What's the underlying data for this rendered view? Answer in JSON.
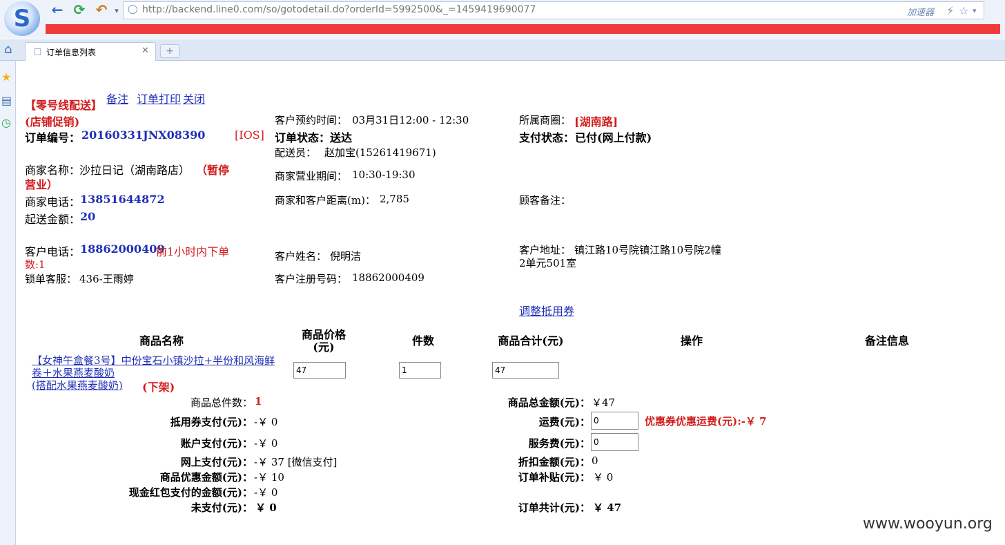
{
  "browser": {
    "url": "http://backend.line0.com/so/gotodetail.do?orderId=5992500&_=1459419690077",
    "accelerator": "加速器",
    "tab_title": "订单信息列表",
    "logo_glyph": "S",
    "icons": {
      "back": "back-arrow-icon",
      "refresh": "refresh-icon",
      "undo": "undo-icon"
    }
  },
  "header": {
    "delivery_tag": "【零号线配送】",
    "links": {
      "remark": "备注",
      "print": "订单打印",
      "close": "关闭"
    },
    "promo_tag": "(店铺促销)"
  },
  "order": {
    "number_label": "订单编号：",
    "number": "20160331JNX08390",
    "platform": "[IOS]",
    "merchant_name_label": "商家名称：",
    "merchant_name": "沙拉日记（湖南路店）",
    "merchant_status_line1": "（暂停",
    "merchant_status_line2": "营业）",
    "merchant_phone_label": "商家电话：",
    "merchant_phone": "13851644872",
    "min_amount_label": "起送金额：",
    "min_amount": "20",
    "customer_phone_label": "客户电话：",
    "customer_phone": "18862000409",
    "recent_orders_line1": "前1小时内下单",
    "recent_orders_line2": "数:1",
    "lock_cs_label": "锁单客服：",
    "lock_cs": "436-王雨婷",
    "appointment_label": "客户预约时间：",
    "appointment": "03月31日12:00 - 12:30",
    "status_label": "订单状态：",
    "status": "送达",
    "courier_label": "配送员：",
    "courier": "赵加宝(15261419671)",
    "hours_label": "商家营业期间：",
    "hours": "10:30-19:30",
    "distance_label": "商家和客户距离(m)：",
    "distance": "2,785",
    "customer_name_label": "客户姓名：",
    "customer_name": "倪明洁",
    "reg_phone_label": "客户注册号码：",
    "reg_phone": "18862000409",
    "district_label": "所属商圈：",
    "district": "[湖南路]",
    "pay_status_label": "支付状态：",
    "pay_status": "已付(网上付款)",
    "customer_note_label": "顾客备注：",
    "address_label": "客户地址：",
    "address_line1": "镇江路10号院镇江路10号院2幢",
    "address_line2": "2单元501室",
    "adjust_coupon": "调整抵用券"
  },
  "table": {
    "headers": {
      "name": "商品名称",
      "price_line1": "商品价格",
      "price_line2": "(元)",
      "qty": "件数",
      "subtotal": "商品合计(元)",
      "action": "操作",
      "note": "备注信息"
    },
    "rows": [
      {
        "name_line1": "【女神午盒餐3号】中份宝石小镇沙拉+半份和风海鲜",
        "name_line2": "卷＋水果燕麦酸奶",
        "name_line3": "(搭配水果燕麦酸奶)",
        "status": "(下架)",
        "price": "47",
        "qty": "1",
        "subtotal": "47"
      }
    ]
  },
  "summary": {
    "total_items_label": "商品总件数：",
    "total_items": "1",
    "coupon_pay_label": "抵用券支付(元)：",
    "coupon_pay": "-￥ 0",
    "account_pay_label": "账户支付(元)：",
    "account_pay": "-￥ 0",
    "online_pay_label": "网上支付(元)：",
    "online_pay": "-￥ 37 [微信支付]",
    "goods_discount_label": "商品优惠金额(元)：",
    "goods_discount": "-￥ 10",
    "redpacket_label": "现金红包支付的金额(元)：",
    "redpacket": "-￥ 0",
    "unpaid_label": "未支付(元)：",
    "unpaid": "￥ 0",
    "goods_total_label": "商品总金额(元)：",
    "goods_total": "￥47",
    "shipping_label": "运费(元)：",
    "shipping": "0",
    "shipping_coupon": "优惠券优惠运费(元):-￥ 7",
    "service_fee_label": "服务费(元)：",
    "service_fee": "0",
    "discount_label": "折扣金额(元)：",
    "discount": "0",
    "subsidy_label": "订单补贴(元)：",
    "subsidy": "￥ 0",
    "order_total_label": "订单共计(元)：",
    "order_total": "￥ 47"
  },
  "watermark": "www.wooyun.org",
  "colors": {
    "red": "#d21c1c",
    "blue": "#1f2fb5",
    "redbar": "#f03a3a"
  }
}
